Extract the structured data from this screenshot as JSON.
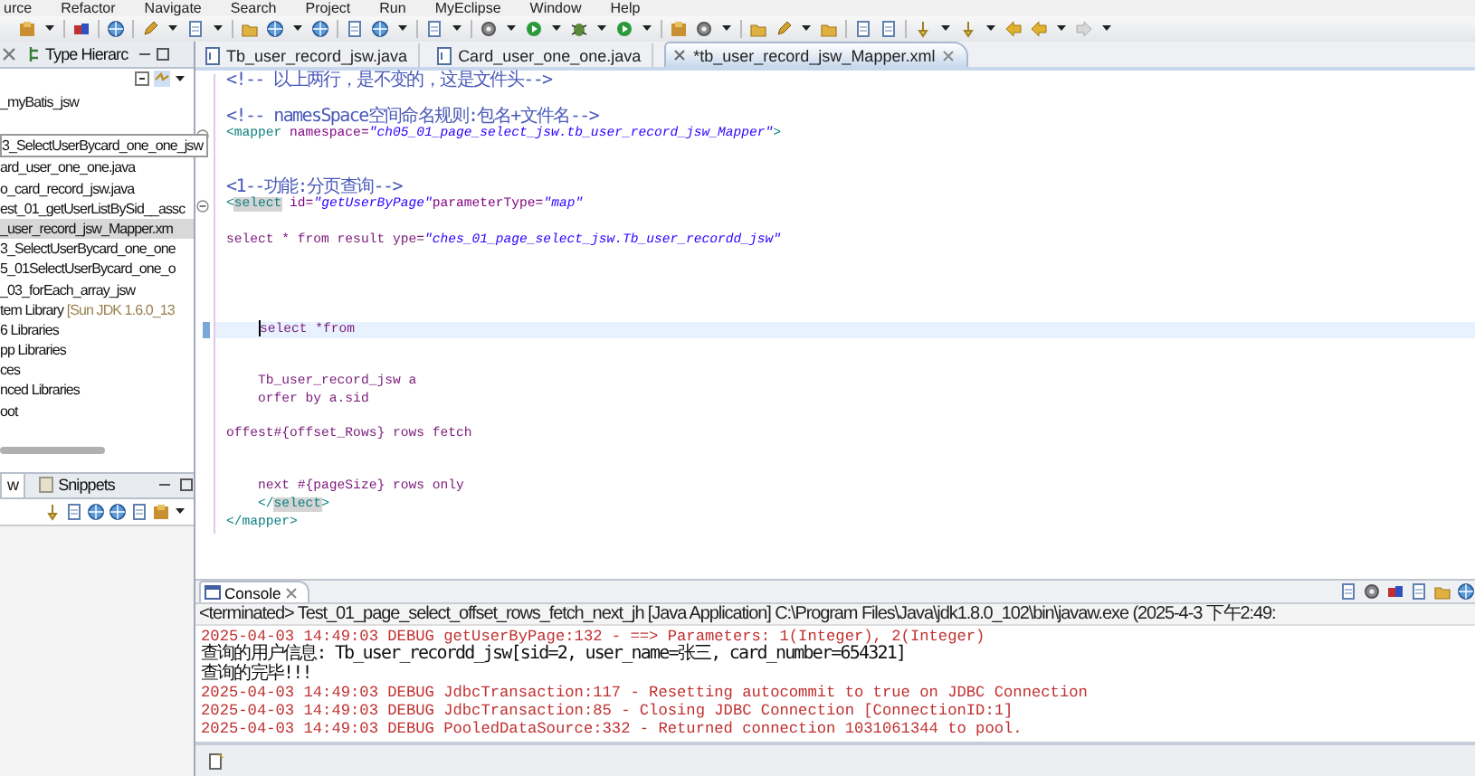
{
  "menu": [
    "urce",
    "Refactor",
    "Navigate",
    "Search",
    "Project",
    "Run",
    "MyEclipse",
    "Window",
    "Help"
  ],
  "explorer": {
    "tabs": [
      {
        "label": "Type Hierarc",
        "selected": false
      }
    ],
    "items": [
      {
        "label": "_myBatis_jsw",
        "kind": "node",
        "selected": false
      },
      {
        "label": "3_SelectUserBycard_one_one_jsw",
        "kind": "tooltip",
        "selected": false
      },
      {
        "label": "ard_user_one_one.java",
        "kind": "node",
        "selected": false
      },
      {
        "label": "o_card_record_jsw.java",
        "kind": "node",
        "selected": false
      },
      {
        "label": "est_01_getUserListBySid__assc",
        "kind": "node",
        "selected": false
      },
      {
        "label": "_user_record_jsw_Mapper.xm",
        "kind": "node",
        "selected": true
      },
      {
        "label": "3_SelectUserBycard_one_one",
        "kind": "node",
        "selected": false
      },
      {
        "label": "5_01SelectUserBycard_one_o",
        "kind": "node",
        "selected": false
      },
      {
        "label": "_03_forEach_array_jsw",
        "kind": "node",
        "selected": false
      },
      {
        "label": "tem Library",
        "decoration": "[Sun JDK 1.6.0_13",
        "kind": "node",
        "selected": false
      },
      {
        "label": "6 Libraries",
        "kind": "node",
        "selected": false
      },
      {
        "label": "pp Libraries",
        "kind": "node",
        "selected": false
      },
      {
        "label": "ces",
        "kind": "node",
        "selected": false
      },
      {
        "label": "nced Libraries",
        "kind": "node",
        "selected": false
      },
      {
        "label": "oot",
        "kind": "node",
        "selected": false
      }
    ],
    "bottom_tabs": [
      {
        "label": "w",
        "selected": true
      },
      {
        "label": "Snippets",
        "selected": false
      }
    ]
  },
  "editor": {
    "tabs": [
      {
        "label": "Tb_user_record_jsw.java",
        "selected": false
      },
      {
        "label": "Card_user_one_one.java",
        "selected": false
      },
      {
        "label": "*tb_user_record_jsw_Mapper.xml",
        "selected": true
      }
    ],
    "lines": [
      {
        "fold": false,
        "current": false,
        "segs": [
          {
            "kind": "comment",
            "text": "<!-- 以上两行，是不变的，这是文件头-->"
          }
        ]
      },
      {
        "fold": false,
        "current": false
      },
      {
        "fold": false,
        "current": false,
        "segs": [
          {
            "kind": "comment",
            "text": "<!-- namesSpace空间命名规则:包名+文件名-->"
          }
        ]
      },
      {
        "fold": true,
        "current": false,
        "segs": [
          {
            "kind": "tag",
            "text": "<mapper "
          },
          {
            "kind": "attr",
            "text": "namespace="
          },
          {
            "kind": "value",
            "text": "\"ch05_01_page_select_jsw.tb_user_record_jsw_Mapper\""
          },
          {
            "kind": "tag",
            "text": ">"
          }
        ]
      },
      {
        "fold": false,
        "current": false
      },
      {
        "fold": false,
        "current": false
      },
      {
        "fold": false,
        "current": false,
        "segs": [
          {
            "kind": "comment",
            "text": "<1--功能:分页查询-->"
          }
        ]
      },
      {
        "fold": true,
        "current": false,
        "segs": [
          {
            "kind": "tag",
            "text": "<"
          },
          {
            "kind": "match",
            "text": "select"
          },
          {
            "kind": "attr",
            "text": " id="
          },
          {
            "kind": "value",
            "text": "\"getUserByPage\""
          },
          {
            "kind": "attr",
            "text": "parameterType="
          },
          {
            "kind": "value",
            "text": "\"map\""
          }
        ]
      },
      {
        "fold": false,
        "current": false
      },
      {
        "fold": false,
        "current": false,
        "segs": [
          {
            "kind": "text",
            "text": "select * from result ype="
          },
          {
            "kind": "value",
            "text": "\"ches_01_page_select_jsw.Tb_user_recordd_jsw\""
          }
        ]
      },
      {
        "fold": false,
        "current": false
      },
      {
        "fold": false,
        "current": false
      },
      {
        "fold": false,
        "current": false
      },
      {
        "fold": false,
        "current": false
      },
      {
        "fold": false,
        "current": true,
        "segs": [
          {
            "kind": "text",
            "text": "    select *from"
          }
        ]
      },
      {
        "fold": false,
        "current": false
      },
      {
        "fold": false,
        "current": false
      },
      {
        "fold": false,
        "current": false,
        "segs": [
          {
            "kind": "text",
            "text": "    Tb_user_record_jsw a"
          }
        ]
      },
      {
        "fold": false,
        "current": false,
        "segs": [
          {
            "kind": "text",
            "text": "    orfer by a.sid"
          }
        ]
      },
      {
        "fold": false,
        "current": false
      },
      {
        "fold": false,
        "current": false,
        "segs": [
          {
            "kind": "text",
            "text": "offest#{offset_Rows} rows fetch"
          }
        ]
      },
      {
        "fold": false,
        "current": false
      },
      {
        "fold": false,
        "current": false
      },
      {
        "fold": false,
        "current": false,
        "segs": [
          {
            "kind": "text",
            "text": "    next #{pageSize} rows only"
          }
        ]
      },
      {
        "fold": false,
        "current": false,
        "segs": [
          {
            "kind": "tag",
            "text": "    </"
          },
          {
            "kind": "match",
            "text": "select"
          },
          {
            "kind": "tag",
            "text": ">"
          }
        ]
      },
      {
        "fold": false,
        "current": false,
        "segs": [
          {
            "kind": "tag",
            "text": "</mapper>"
          }
        ]
      }
    ]
  },
  "console": {
    "tab": "Console",
    "header": "<terminated> Test_01_page_select_offset_rows_fetch_next_jh [Java Application] C:\\Program Files\\Java\\jdk1.8.0_102\\bin\\javaw.exe (2025-4-3 下午2:49:",
    "lines": [
      {
        "kind": "debug",
        "text": "2025-04-03 14:49:03 DEBUG getUserByPage:132 - ==> Parameters: 1(Integer), 2(Integer)"
      },
      {
        "kind": "output",
        "text": "查询的用户信息: Tb_user_recordd_jsw[sid=2, user_name=张三, card_number=654321]"
      },
      {
        "kind": "output",
        "text": "查询的完毕!!!"
      },
      {
        "kind": "debug",
        "text": "2025-04-03 14:49:03 DEBUG JdbcTransaction:117 - Resetting autocommit to true on JDBC Connection"
      },
      {
        "kind": "debug",
        "text": "2025-04-03 14:49:03 DEBUG JdbcTransaction:85 - Closing JDBC Connection [ConnectionID:1]"
      },
      {
        "kind": "debug",
        "text": "2025-04-03 14:49:03 DEBUG PooledDataSource:332 - Returned connection 1031061344 to pool."
      }
    ]
  }
}
